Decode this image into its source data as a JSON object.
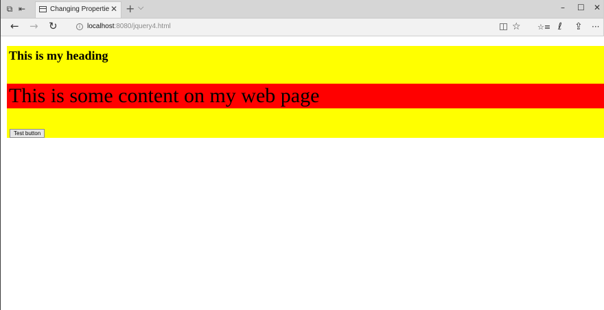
{
  "browser": {
    "tab": {
      "title": "Changing Properties wit",
      "close": "✕"
    },
    "new_tab": "+",
    "tab_menu": "⌵",
    "window_controls": {
      "minimize": "–",
      "maximize": "☐",
      "close": "✕"
    },
    "nav": {
      "back": "←",
      "forward": "→",
      "refresh": "↻"
    },
    "address": {
      "host": "localhost",
      "path": ":8080/jquery4.html"
    },
    "toolbar_icons": [
      "reading-view-icon",
      "favorite-star-icon",
      "favorites-hub-icon",
      "pen-icon",
      "share-icon",
      "more-icon"
    ],
    "toolbar_glyphs": {
      "star": "☆",
      "hub": "☆≡",
      "pen": "ℓ",
      "share": "⇪",
      "more": "···"
    }
  },
  "page": {
    "heading": "This is my heading",
    "paragraph": "This is some content on my web page",
    "button_label": "Test button",
    "colors": {
      "block_background": "#ffff00",
      "paragraph_background": "#ff0000"
    }
  }
}
